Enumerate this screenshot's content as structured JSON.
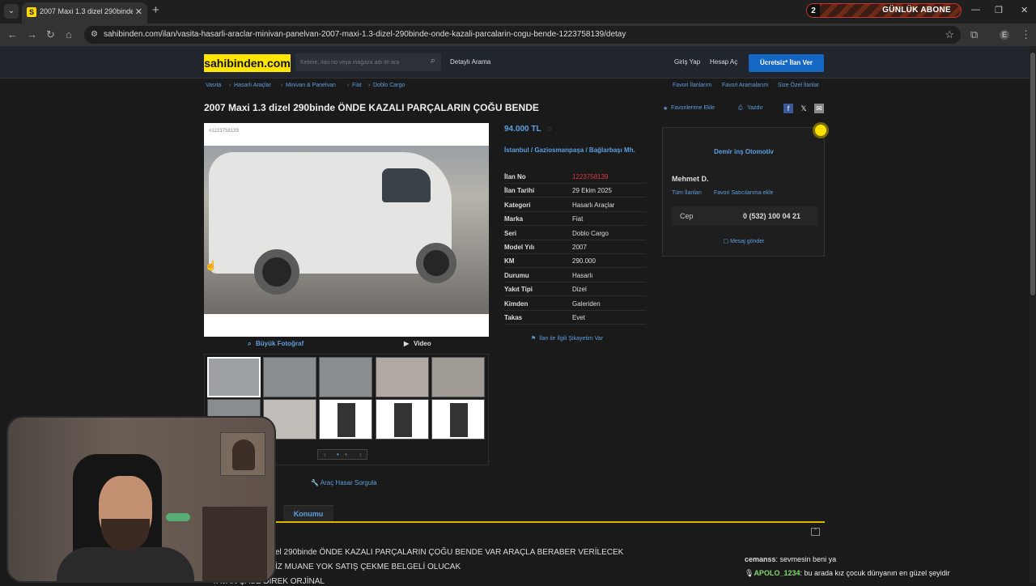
{
  "browser": {
    "tab_title": "2007 Maxi 1.3 dizel 290binde ÖNDE KAZALI PARÇALARIN ÇOĞU BENDE",
    "favicon_letter": "S",
    "url": "sahibinden.com/ilan/vasita-hasarli-araclar-minivan-panelvan-2007-maxi-1.3-dizel-290binde-onde-kazali-parcalarin-cogu-bende-1223758139/detay",
    "overlay_badge": {
      "number": "2",
      "text": "GÜNLÜK ABONE"
    },
    "profile_letter": "E"
  },
  "header": {
    "logo": "sahibinden.com",
    "search_placeholder": "Kelime, ilan no veya mağaza adı ile ara",
    "detailed_search": "Detaylı Arama",
    "login": "Giriş Yap",
    "register": "Hesap Aç",
    "post_ad": "Ücretsiz* İlan Ver"
  },
  "breadcrumb": [
    "Vasıta",
    "Hasarlı Araçlar",
    "Minivan & Panelvan",
    "Fiat",
    "Doblo Cargo"
  ],
  "top_links": [
    "Favori İlanlarım",
    "Favori Aramalarım",
    "Size Özel İlanlar"
  ],
  "title": "2007 Maxi 1.3 dizel 290binde ÖNDE KAZALI PARÇALARIN ÇOĞU BENDE",
  "actions": {
    "favorite": "Favorilerime Ekle",
    "print": "Yazdır"
  },
  "gallery": {
    "listing_no_overlay": "#1223758139",
    "large_photo": "Büyük Fotoğraf",
    "video": "Video",
    "vehicle_inspection": "Araç Hasar Sorgula"
  },
  "listing": {
    "price": "94.000 TL",
    "location": "İstanbul / Gaziosmanpaşa / Bağlarbaşı Mh.",
    "details": [
      {
        "k": "İlan No",
        "v": "1223758139"
      },
      {
        "k": "İlan Tarihi",
        "v": "29 Ekim 2025"
      },
      {
        "k": "Kategori",
        "v": "Hasarlı Araçlar"
      },
      {
        "k": "Marka",
        "v": "Fiat"
      },
      {
        "k": "Seri",
        "v": "Doblo Cargo"
      },
      {
        "k": "Model Yılı",
        "v": "2007"
      },
      {
        "k": "KM",
        "v": "290.000"
      },
      {
        "k": "Durumu",
        "v": "Hasarlı"
      },
      {
        "k": "Yakıt Tipi",
        "v": "Dizel"
      },
      {
        "k": "Kimden",
        "v": "Galeriden"
      },
      {
        "k": "Takas",
        "v": "Evet"
      }
    ],
    "complaint": "İlan ile İlgili Şikayetim Var"
  },
  "seller": {
    "store": "Demir inş Otomotiv",
    "name": "Mehmet D.",
    "all_listings": "Tüm İlanları",
    "favorite_sellers": "Favori Satıcılarıma ekle",
    "phone_label": "Cep",
    "phone": "0 (532) 100 04 21",
    "message": "Mesaj gönder"
  },
  "tabs": {
    "location": "Konumu"
  },
  "description": [
    "el 290binde ÖNDE KAZALI PARÇALARIN ÇOĞU BENDE VAR ARAÇLA BERABER VERİLECEK",
    "İZ MUANE YOK SATIŞ ÇEKME BELGELİ OLUCAK",
    "TAVAN ŞASE DİREK ORJİNAL"
  ],
  "chat": [
    {
      "user": "cemanss",
      "text": "sevmesin beni ya"
    },
    {
      "user": "APOLO_1234",
      "text": "bu arada kız çocuk dünyanın en güzel şeyidir"
    }
  ],
  "colors": {
    "brand_yellow": "#ffe500",
    "link_blue": "#5d9fe0",
    "cta_blue": "#1567c4",
    "accent": "#e3b400"
  }
}
